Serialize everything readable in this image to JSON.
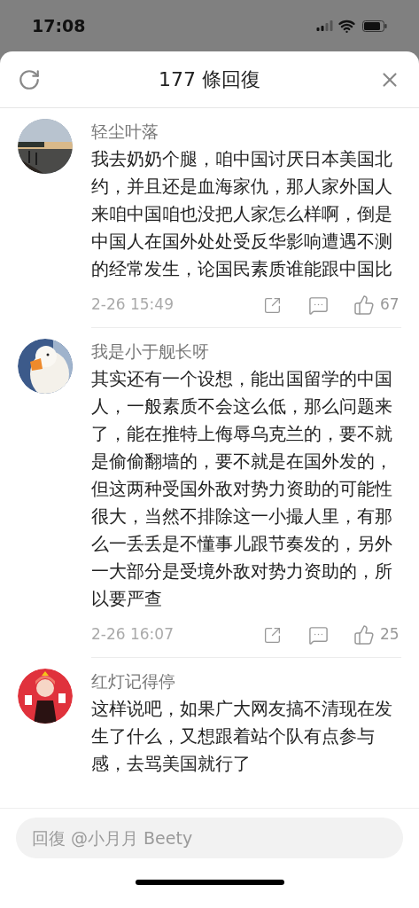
{
  "status_bar": {
    "time": "17:08"
  },
  "header": {
    "title": "177 條回復"
  },
  "comments": [
    {
      "author": "轻尘叶落",
      "text": "我去奶奶个腿，咱中国讨厌日本美国北约，并且还是血海家仇，那人家外国人来咱中国咱也没把人家怎么样啊，倒是中国人在国外处处受反华影响遭遇不测的经常发生，论国民素质谁能跟中国比",
      "time": "2-26 15:49",
      "likes": "67"
    },
    {
      "author": "我是小于舰长呀",
      "text": "其实还有一个设想，能出国留学的中国人，一般素质不会这么低，那么问题来了，能在推特上侮辱乌克兰的，要不就是偷偷翻墙的，要不就是在国外发的，但这两种受国外敌对势力资助的可能性很大，当然不排除这一小撮人里，有那么一丢丢是不懂事儿跟节奏发的，另外一大部分是受境外敌对势力资助的，所以要严查",
      "time": "2-26 16:07",
      "likes": "25"
    },
    {
      "author": "红灯记得停",
      "text": "这样说吧，如果广大网友搞不清现在发生了什么，又想跟着站个队有点参与感，去骂美国就行了"
    }
  ],
  "reply_field": {
    "placeholder": "回復 @小月月 Beety"
  }
}
